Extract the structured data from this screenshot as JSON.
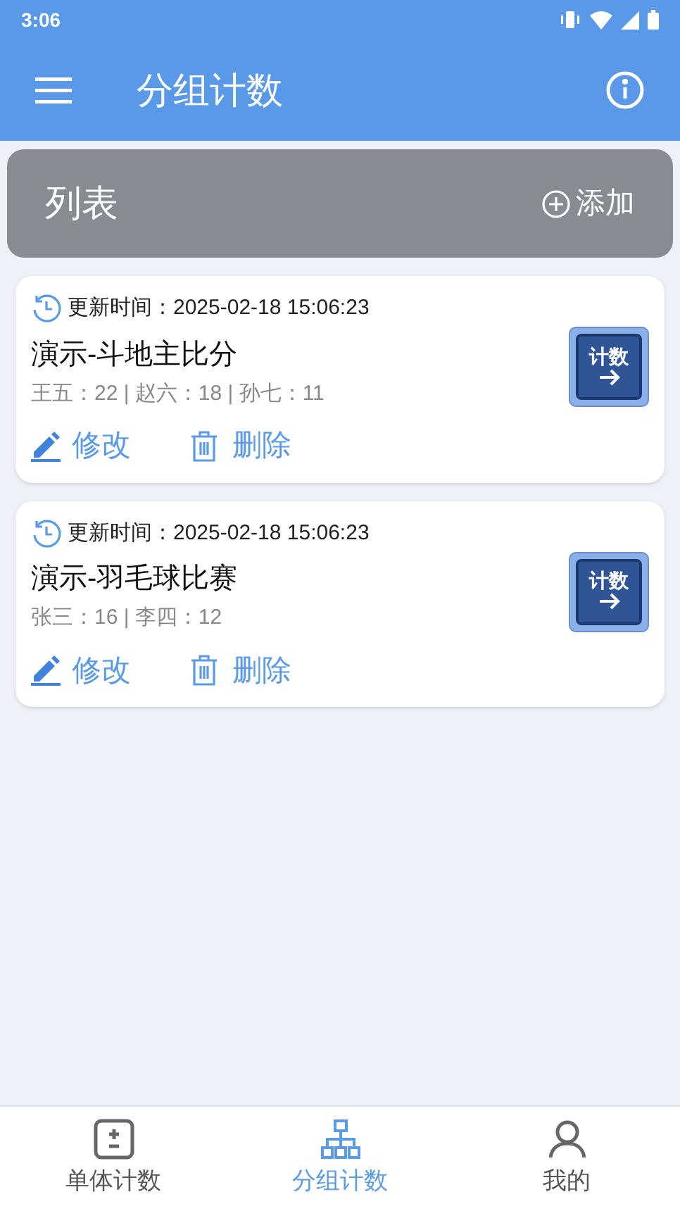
{
  "status_bar": {
    "time": "3:06"
  },
  "app_bar": {
    "title": "分组计数"
  },
  "list_header": {
    "title": "列表",
    "add_label": "添加"
  },
  "groups": [
    {
      "updated_label": "更新时间：",
      "updated": "2025-02-18 15:06:23",
      "name": "演示-斗地主比分",
      "scores": "王五：22 | 赵六：18 | 孙七：11",
      "count_label": "计数",
      "edit_label": "修改",
      "delete_label": "删除"
    },
    {
      "updated_label": "更新时间：",
      "updated": "2025-02-18 15:06:23",
      "name": "演示-羽毛球比赛",
      "scores": "张三：16 | 李四：12",
      "count_label": "计数",
      "edit_label": "修改",
      "delete_label": "删除"
    }
  ],
  "bottom_nav": [
    {
      "kind": "single",
      "label": "单体计数",
      "selected": false
    },
    {
      "kind": "group",
      "label": "分组计数",
      "selected": true
    },
    {
      "kind": "mine",
      "label": "我的",
      "selected": false
    }
  ]
}
